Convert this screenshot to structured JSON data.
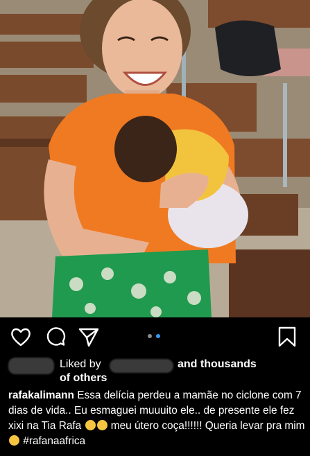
{
  "post": {
    "photo_label": "photo",
    "likes": {
      "liked_by": "Liked by",
      "and_thousands": "and thousands",
      "of_others": "of others"
    },
    "caption": {
      "username": "rafakalimann",
      "text_part1": "Essa delícia perdeu a mamãe no ciclone com 7 dias de vida.. Eu esmaguei muuuito ele.. de presente ele fez xixi na Tia Rafa",
      "text_part2": "meu útero coça!!!!!! Queria levar pra mim",
      "hashtag": "#rafanaafrica"
    },
    "carousel": {
      "total": 2,
      "active": 2
    }
  },
  "icons": {
    "like": "heart-icon",
    "comment": "comment-icon",
    "share": "send-icon",
    "save": "bookmark-icon"
  },
  "colors": {
    "background": "#000000",
    "text": "#ffffff",
    "carousel_active": "#3897f0",
    "carousel_inactive": "#8a8a8a"
  }
}
